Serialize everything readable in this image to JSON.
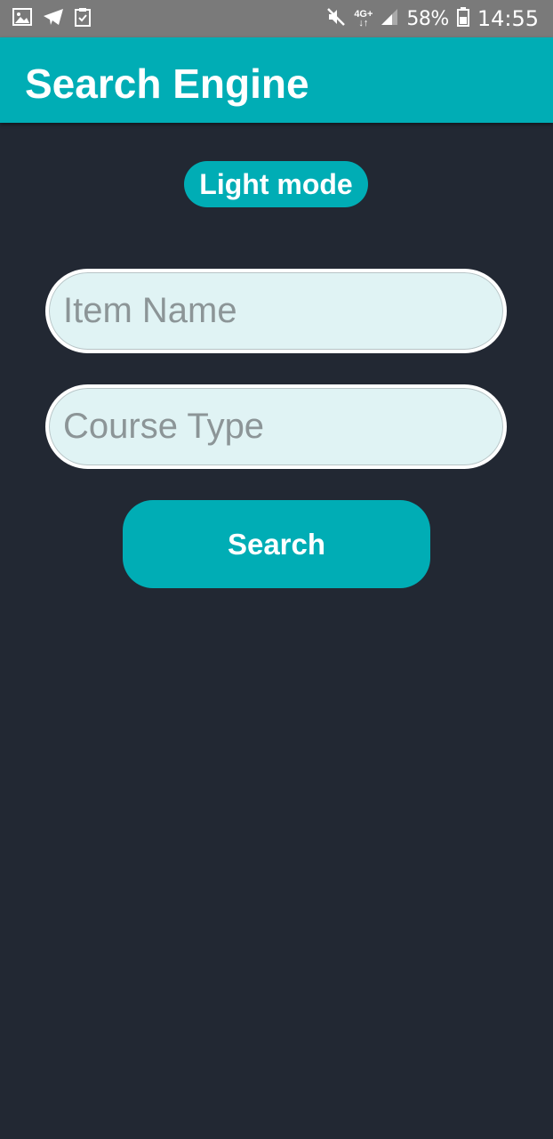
{
  "status_bar": {
    "left_icons": [
      "image-icon",
      "telegram-icon",
      "clipboard-check-icon"
    ],
    "network_label_top": "4G+",
    "network_label_bottom": "↓↑",
    "battery_percent": "58%",
    "time": "14:55"
  },
  "app_bar": {
    "title": "Search Engine"
  },
  "mode_toggle": {
    "label": "Light mode"
  },
  "form": {
    "item_name_placeholder": "Item Name",
    "course_type_placeholder": "Course Type",
    "search_label": "Search"
  },
  "colors": {
    "accent": "#00adb5",
    "background": "#222833",
    "field_background": "#e0f3f4",
    "status_bar": "#7a7a7a"
  }
}
